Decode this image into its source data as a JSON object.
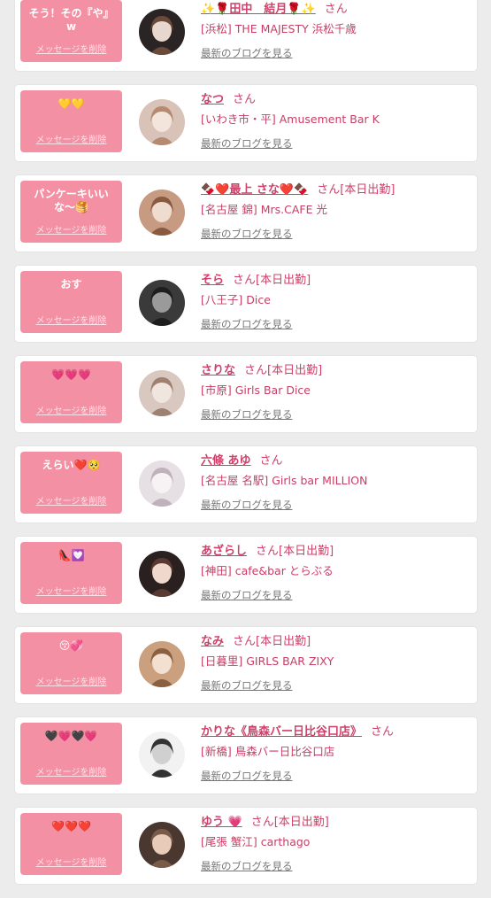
{
  "colors": {
    "accent": "#f490a4",
    "name": "#d0406a",
    "link_gray": "#777777",
    "background": "#ececec"
  },
  "common": {
    "delete_label": "メッセージを削除",
    "blog_label": "最新のブログを見る"
  },
  "items": [
    {
      "message": "そう！その『や』w",
      "name": "✨🌹田中　結月🌹✨",
      "san": "さん",
      "shift": "",
      "shop": "[浜松] THE MAJESTY 浜松千歳",
      "avatar": "woman-photo-icon"
    },
    {
      "message": "💛💛",
      "name": "なつ",
      "san": "さん",
      "shift": "",
      "shop": "[いわき市・平] Amusement Bar K",
      "avatar": "woman-photo-icon"
    },
    {
      "message": "パンケーキいいな〜🥞",
      "name": "🍫❤️最上 さな❤️🍫",
      "san": "さん",
      "shift": "[本日出勤]",
      "shop": "[名古屋 錦] Mrs.CAFE 光",
      "avatar": "woman-photo-icon"
    },
    {
      "message": "おす",
      "name": "そら",
      "san": "さん",
      "shift": "[本日出勤]",
      "shop": "[八王子] Dice",
      "avatar": "woman-photo-icon"
    },
    {
      "message": "💗💗💗",
      "name": "さりな",
      "san": "さん",
      "shift": "[本日出勤]",
      "shop": "[市原] Girls Bar Dice",
      "avatar": "woman-photo-icon"
    },
    {
      "message": "えらい❤️🥺",
      "name": "六條 あゆ",
      "san": "さん",
      "shift": "",
      "shop": "[名古屋 名駅] Girls bar MILLION",
      "avatar": "woman-photo-icon"
    },
    {
      "message": "👠💟",
      "name": "あざらし",
      "san": "さん",
      "shift": "[本日出勤]",
      "shop": "[神田] cafe&bar とらぶる",
      "avatar": "woman-photo-icon"
    },
    {
      "message": "😚💞",
      "name": "なみ",
      "san": "さん",
      "shift": "[本日出勤]",
      "shop": "[日暮里] GIRLS BAR ZIXY",
      "avatar": "woman-photo-icon"
    },
    {
      "message": "🖤💗🖤💗",
      "name": "かりな《鳥森バー日比谷口店》",
      "san": "さん",
      "shift": "",
      "shop": "[新橋] 鳥森バー日比谷口店",
      "avatar": "woman-photo-icon"
    },
    {
      "message": "❤️❤️❤️",
      "name": "ゆう 💗",
      "san": "さん",
      "shift": "[本日出勤]",
      "shop": "[尾張 蟹江] carthago",
      "avatar": "woman-photo-icon"
    }
  ]
}
